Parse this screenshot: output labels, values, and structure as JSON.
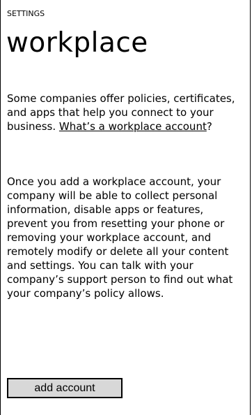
{
  "header": {
    "section_label": "SETTINGS",
    "title": "workplace"
  },
  "intro": {
    "text_before_link": "Some companies offer policies, certificates, and apps that help you connect to your business. ",
    "link_label": "What’s a workplace account",
    "text_after_link": "?"
  },
  "warning": {
    "text": "Once you add a workplace account, your company will be able to collect personal information, disable apps or features, prevent you from resetting your phone or removing your workplace account, and remotely modify or delete all your content and settings. You can talk with your company’s support person to find out what your company’s policy allows."
  },
  "actions": {
    "add_account_label": "add account"
  },
  "colors": {
    "background": "#ffffff",
    "text": "#000000",
    "button_background": "#d8d8d8"
  }
}
